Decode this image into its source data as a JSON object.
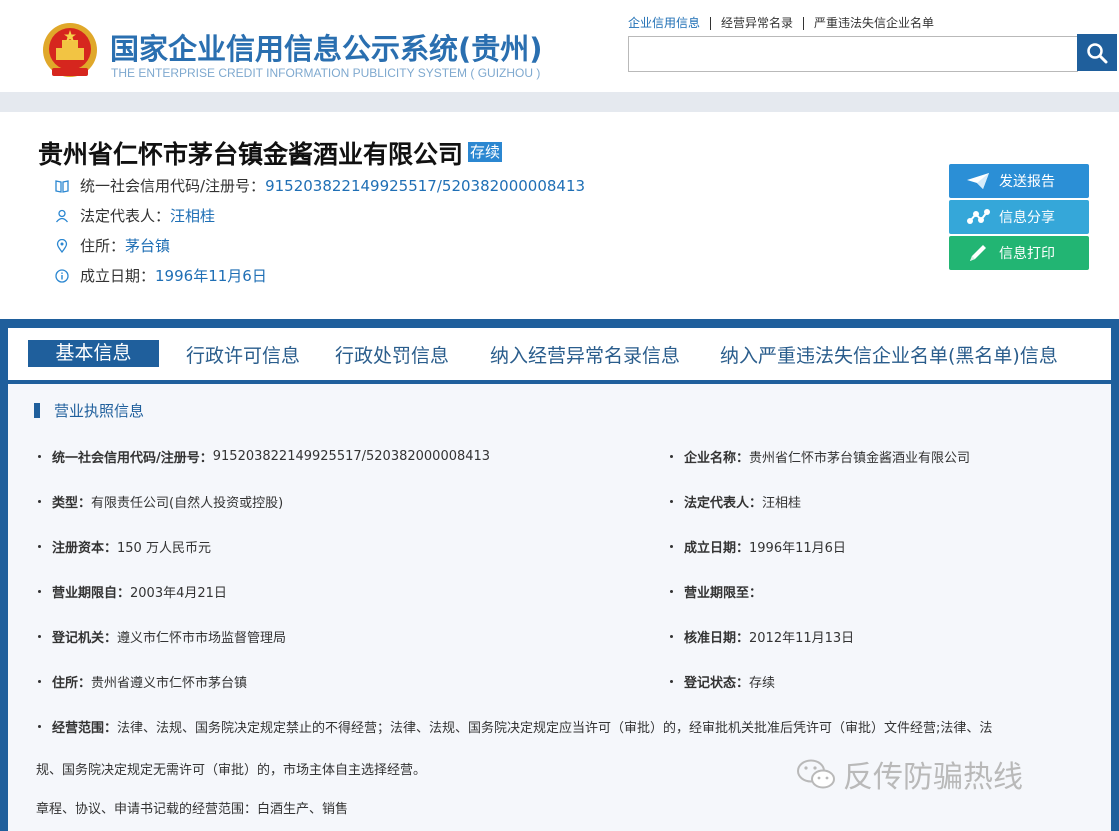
{
  "header": {
    "title": "国家企业信用信息公示系统(贵州)",
    "subtitle": "THE ENTERPRISE CREDIT INFORMATION PUBLICITY SYSTEM ( GUIZHOU )",
    "links": [
      "企业信用信息",
      "经营异常名录",
      "严重违法失信企业名单"
    ],
    "search_placeholder": ""
  },
  "company": {
    "name": "贵州省仁怀市茅台镇金酱酒业有限公司",
    "status": "存续",
    "credit_label": "统一社会信用代码/注册号：",
    "credit_value": "915203822149925517/520382000008413",
    "rep_label": "法定代表人：",
    "rep_value": "汪相桂",
    "addr_label": "住所：",
    "addr_value": "茅台镇",
    "date_label": "成立日期：",
    "date_value": "1996年11月6日"
  },
  "actions": {
    "report": "发送报告",
    "share": "信息分享",
    "print": "信息打印"
  },
  "tabs": [
    "基本信息",
    "行政许可信息",
    "行政处罚信息",
    "纳入经营异常名录信息",
    "纳入严重违法失信企业名单(黑名单)信息"
  ],
  "section": {
    "title": "营业执照信息",
    "fields": [
      {
        "label": "统一社会信用代码/注册号：",
        "value": "915203822149925517/520382000008413"
      },
      {
        "label": "企业名称：",
        "value": "贵州省仁怀市茅台镇金酱酒业有限公司"
      },
      {
        "label": "类型：",
        "value": "有限责任公司(自然人投资或控股)"
      },
      {
        "label": "法定代表人：",
        "value": "汪相桂"
      },
      {
        "label": "注册资本：",
        "value": "150 万人民币元"
      },
      {
        "label": "成立日期：",
        "value": "1996年11月6日"
      },
      {
        "label": "营业期限自：",
        "value": "2003年4月21日"
      },
      {
        "label": "营业期限至：",
        "value": ""
      },
      {
        "label": "登记机关：",
        "value": "遵义市仁怀市市场监督管理局"
      },
      {
        "label": "核准日期：",
        "value": "2012年11月13日"
      },
      {
        "label": "住所：",
        "value": "贵州省遵义市仁怀市茅台镇"
      },
      {
        "label": "登记状态：",
        "value": "存续"
      }
    ],
    "scope_label": "经营范围：",
    "scope_line1": "法律、法规、国务院决定规定禁止的不得经营；法律、法规、国务院决定规定应当许可（审批）的，经审批机关批准后凭许可（审批）文件经营;法律、法",
    "scope_line2": "规、国务院决定规定无需许可（审批）的，市场主体自主选择经营。",
    "scope_line3": "章程、协议、申请书记载的经营范围：白酒生产、销售"
  },
  "watermark": "反传防骗热线",
  "colors": {
    "primary": "#1f5f9c",
    "link": "#1f6fb5",
    "report_btn": "#2b8fd6",
    "share_btn": "#35a7d9",
    "print_btn": "#22b573"
  }
}
